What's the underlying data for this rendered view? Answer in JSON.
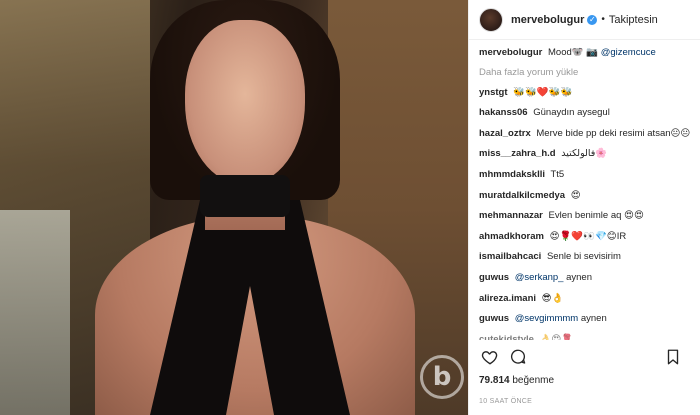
{
  "post": {
    "author": "mervebolugur",
    "follow_status": "Takiptesin",
    "likes_count": "79.814",
    "likes_label": "beğenme",
    "time_ago": "10 SAAT ÖNCE",
    "watermark": "b"
  },
  "caption": {
    "user": "mervebolugur",
    "text": "Mood🐨 📷",
    "mention": "@gizemcuce"
  },
  "load_more": "Daha fazla yorum yükle",
  "comments": [
    {
      "user": "ynstgt",
      "text": "🐝🐝❤️🐝🐝"
    },
    {
      "user": "hakanss06",
      "text": "Günaydın aysegul"
    },
    {
      "user": "hazal_oztrx",
      "text": "Merve bide pp deki resimi atsan😐😐"
    },
    {
      "user": "miss__zahra_h.d",
      "text": "فالولكتید🌸"
    },
    {
      "user": "mhmmdakskIli",
      "text": "Tt5"
    },
    {
      "user": "muratdalkilcmedya",
      "text": "😍"
    },
    {
      "user": "mehmannazar",
      "text": "Evlen benimle aq 😍😍"
    },
    {
      "user": "ahmadkhoram",
      "text": "😍🌹❤️👀💎😊IR"
    },
    {
      "user": "ismailbahcaci",
      "text": "Senle bi sevisirim"
    },
    {
      "user": "guwus",
      "mention": "@serkanp_",
      "text": "aynen"
    },
    {
      "user": "alireza.imani",
      "text": "😎👌"
    },
    {
      "user": "guwus",
      "mention": "@sevgimmmm",
      "text": "aynen"
    },
    {
      "user": "cutekidstyle",
      "text": "👌😍🌹"
    }
  ],
  "icons": {
    "heart": "heart-icon",
    "comment": "comment-icon",
    "bookmark": "bookmark-icon",
    "verified": "verified-badge-icon"
  },
  "colors": {
    "mention": "#003569",
    "verified": "#3897f0",
    "muted": "#999999"
  }
}
